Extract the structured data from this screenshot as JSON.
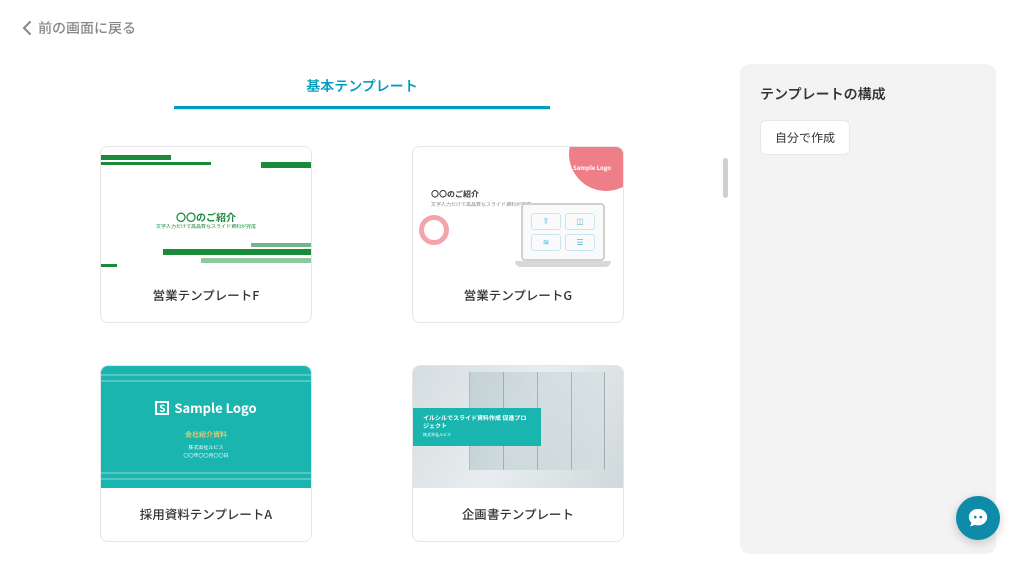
{
  "nav": {
    "back_label": "前の画面に戻る"
  },
  "tabs": {
    "main": "基本テンプレート"
  },
  "templates": [
    {
      "label": "営業テンプレートF",
      "thumb": {
        "headline": "〇〇のご紹介",
        "subline": "文字入力だけで高品質なスライド資料が完成"
      }
    },
    {
      "label": "営業テンプレートG",
      "thumb": {
        "headline": "〇〇のご紹介",
        "subline": "文字入力だけで高品質なスライド資料が完成",
        "logo": "S Sample Logo"
      }
    },
    {
      "label": "採用資料テンプレートA",
      "thumb": {
        "logo": "Sample Logo",
        "mid": "会社紹介資料",
        "s1": "株式会社ルビス",
        "s2": "〇〇年〇〇月〇〇日"
      }
    },
    {
      "label": "企画書テンプレート",
      "thumb": {
        "bar_t": "イルシルでスライド資料作成\n促進プロジェクト",
        "bar_s": "株式会社ルビス"
      }
    }
  ],
  "sidebar": {
    "title": "テンプレートの構成",
    "create_self": "自分で作成"
  }
}
